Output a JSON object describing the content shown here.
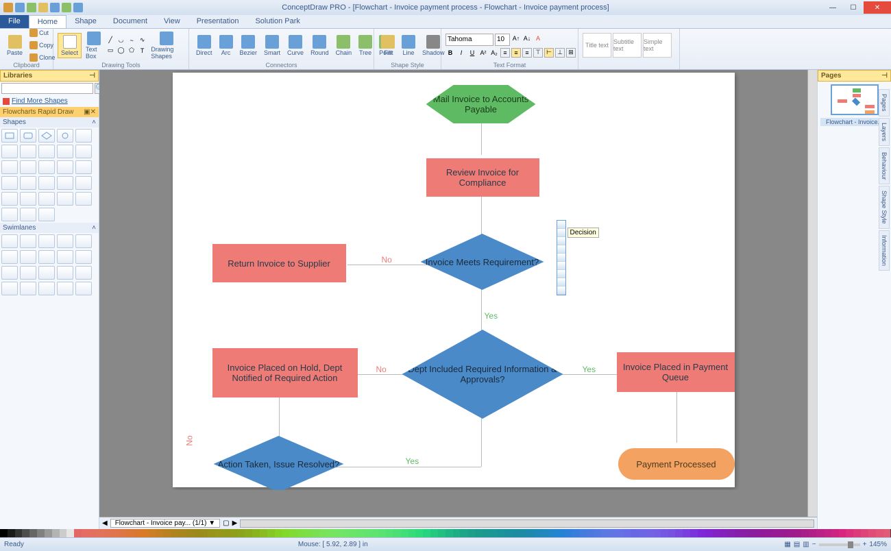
{
  "titlebar": {
    "title": "ConceptDraw PRO - [Flowchart - Invoice payment process - Flowchart - Invoice payment process]"
  },
  "menu": {
    "file": "File",
    "tabs": [
      "Home",
      "Shape",
      "Document",
      "View",
      "Presentation",
      "Solution Park"
    ],
    "active": 0
  },
  "ribbon": {
    "clipboard": {
      "label": "Clipboard",
      "paste": "Paste",
      "cut": "Cut",
      "copy": "Copy",
      "clone": "Clone"
    },
    "drawing": {
      "label": "Drawing Tools",
      "select": "Select",
      "textbox": "Text\nBox",
      "shapes": "Drawing\nShapes"
    },
    "connectors": {
      "label": "Connectors",
      "items": [
        "Direct",
        "Arc",
        "Bezier",
        "Smart",
        "Curve",
        "Round",
        "Chain",
        "Tree",
        "Point"
      ]
    },
    "shapestyle": {
      "label": "Shape Style",
      "fill": "Fill",
      "line": "Line",
      "shadow": "Shadow"
    },
    "textformat": {
      "label": "Text Format",
      "font": "Tahoma",
      "size": "10"
    },
    "styles": {
      "title": "Title text",
      "subtitle": "Subtitle text",
      "simple": "Simple text"
    }
  },
  "leftpanel": {
    "libraries": "Libraries",
    "findmore": "Find More Shapes",
    "section": "Flowcharts Rapid Draw",
    "shapes": "Shapes",
    "swimlanes": "Swimlanes"
  },
  "rightpanel": {
    "pages": "Pages",
    "thumbname": "Flowchart - Invoice...",
    "sidetabs": [
      "Pages",
      "Layers",
      "Behaviour",
      "Shape Style",
      "Information"
    ]
  },
  "flowchart": {
    "n1": "Mail Invoice to Accounts Payable",
    "n2": "Review Invoice for Compliance",
    "n3": "Invoice Meets Requirement?",
    "n4": "Return Invoice to Supplier",
    "n5": "Dept Included Required Information & Approvals?",
    "n6": "Invoice Placed on Hold, Dept Notified of Required Action",
    "n7": "Invoice Placed in Payment Queue",
    "n8": "Action Taken, Issue Resolved?",
    "n9": "Payment Processed",
    "yes": "Yes",
    "no": "No",
    "tooltip": "Decision"
  },
  "pagetab": {
    "name": "Flowchart - Invoice pay...",
    "count": "(1/1)"
  },
  "statusbar": {
    "ready": "Ready",
    "mouse": "Mouse: [ 5.92, 2.89 ] in",
    "zoom": "145%"
  },
  "chart_data": {
    "type": "flowchart",
    "nodes": [
      {
        "id": "n1",
        "type": "start",
        "label": "Mail Invoice to Accounts Payable"
      },
      {
        "id": "n2",
        "type": "process",
        "label": "Review Invoice for Compliance"
      },
      {
        "id": "n3",
        "type": "decision",
        "label": "Invoice Meets Requirement?"
      },
      {
        "id": "n4",
        "type": "process",
        "label": "Return Invoice to Supplier"
      },
      {
        "id": "n5",
        "type": "decision",
        "label": "Dept Included Required Information & Approvals?"
      },
      {
        "id": "n6",
        "type": "process",
        "label": "Invoice Placed on Hold, Dept Notified of Required Action"
      },
      {
        "id": "n7",
        "type": "process",
        "label": "Invoice Placed in Payment Queue"
      },
      {
        "id": "n8",
        "type": "decision",
        "label": "Action Taken, Issue Resolved?"
      },
      {
        "id": "n9",
        "type": "terminator",
        "label": "Payment Processed"
      }
    ],
    "edges": [
      {
        "from": "n1",
        "to": "n2"
      },
      {
        "from": "n2",
        "to": "n3"
      },
      {
        "from": "n3",
        "to": "n4",
        "label": "No"
      },
      {
        "from": "n3",
        "to": "n5",
        "label": "Yes"
      },
      {
        "from": "n5",
        "to": "n6",
        "label": "No"
      },
      {
        "from": "n5",
        "to": "n7",
        "label": "Yes"
      },
      {
        "from": "n6",
        "to": "n8"
      },
      {
        "from": "n8",
        "to": "n5",
        "label": "Yes"
      },
      {
        "from": "n8",
        "to": "n4",
        "label": "No"
      },
      {
        "from": "n7",
        "to": "n9"
      }
    ]
  }
}
